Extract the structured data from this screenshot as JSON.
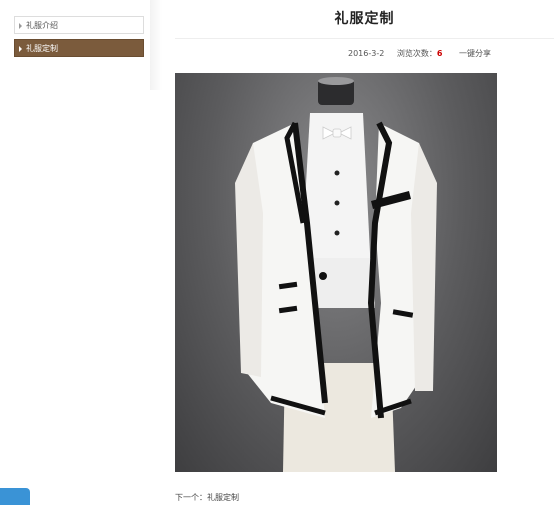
{
  "sidebar": {
    "items": [
      {
        "label": "礼服介绍"
      },
      {
        "label": "礼服定制"
      }
    ]
  },
  "article": {
    "title": "礼服定制",
    "date": "2016-3-2",
    "views_label": "浏览次数：",
    "views_count": "6",
    "share_label": "一键分享",
    "image_subject": "white-tuxedo-jacket-with-black-trim",
    "next_prefix": "下一个：",
    "next_link": "礼服定制"
  },
  "colors": {
    "sidebar_active": "#7b5b3c",
    "views_count": "#cc0000",
    "corner_tab": "#3a93d6"
  }
}
